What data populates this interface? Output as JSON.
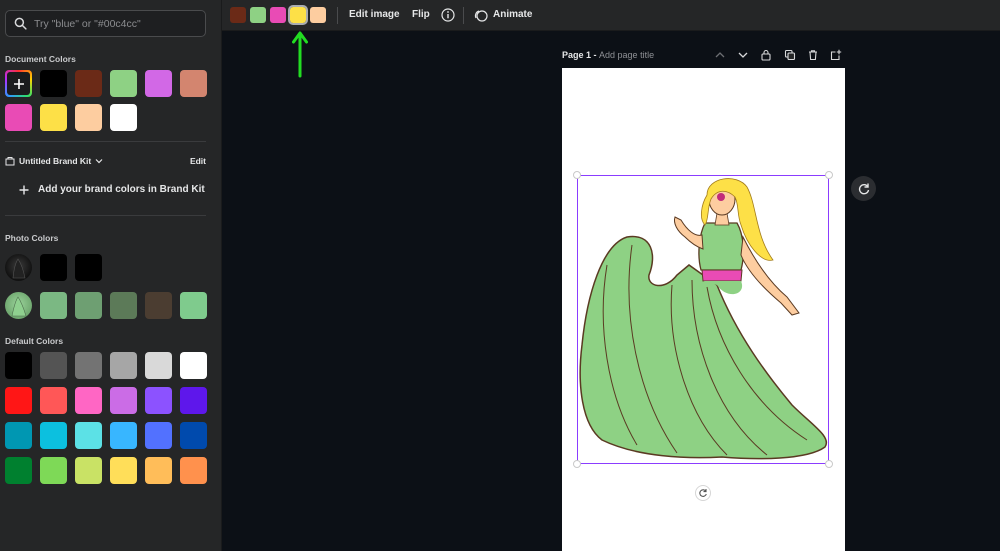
{
  "search": {
    "placeholder": "Try \"blue\" or \"#00c4cc\""
  },
  "sections": {
    "document_colors": "Document Colors",
    "photo_colors": "Photo Colors",
    "default_colors": "Default Colors"
  },
  "document_colors": [
    "#000000",
    "#6b2a17",
    "#8ed184",
    "#d268e6",
    "#d3856f",
    "#e94bb5",
    "#fde047",
    "#fdcda0",
    "#ffffff"
  ],
  "brand": {
    "kit_name": "Untitled Brand Kit",
    "edit_label": "Edit",
    "add_label": "Add your brand colors in Brand Kit"
  },
  "photo_colors_row1": [
    "#000000",
    "#000000"
  ],
  "photo_colors_row2": [
    "#7bb883",
    "#6e9f72",
    "#5c7a58",
    "#4b3d31",
    "#7fcb8d"
  ],
  "default_colors": [
    [
      "#000000",
      "#545454",
      "#737373",
      "#a6a6a6",
      "#d9d9d9",
      "#ffffff"
    ],
    [
      "#ff1616",
      "#ff5757",
      "#ff66c4",
      "#cb6ce6",
      "#8c52ff",
      "#5e17eb"
    ],
    [
      "#0097b2",
      "#0cc0df",
      "#5ce1e6",
      "#38b6ff",
      "#5271ff",
      "#004aad"
    ],
    [
      "#00802f",
      "#7ed957",
      "#c9e265",
      "#ffde59",
      "#ffbd59",
      "#ff914d"
    ]
  ],
  "toolbar": {
    "swatches": [
      "#6b2a17",
      "#8ed184",
      "#e94bb5",
      "#fde047",
      "#fdcda0"
    ],
    "selected_swatch_index": 3,
    "edit_image": "Edit image",
    "flip": "Flip",
    "animate": "Animate"
  },
  "page": {
    "label": "Page 1",
    "separator": " - ",
    "title_placeholder": "Add page title"
  },
  "colors": {
    "accent_selection": "#8b3dff",
    "annotation_arrow": "#22dd22"
  }
}
